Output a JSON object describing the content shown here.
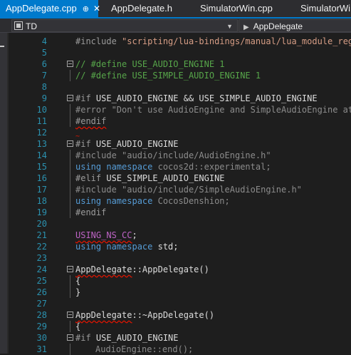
{
  "tabs": [
    {
      "label": "AppDelegate.cpp",
      "active": true,
      "pin": "⊕",
      "close": "✕"
    },
    {
      "label": "AppDelegate.h",
      "active": false
    },
    {
      "label": "SimulatorWin.cpp",
      "active": false
    },
    {
      "label": "SimulatorWin",
      "active": false
    }
  ],
  "nav": {
    "project": "TD",
    "member": "AppDelegate"
  },
  "lines": [
    {
      "num": "4",
      "parts": [
        {
          "t": "#include ",
          "c": "t-pre"
        },
        {
          "t": "\"scripting/lua-bindings/manual/lua_module_regis",
          "c": "t-str"
        }
      ]
    },
    {
      "num": "5",
      "parts": []
    },
    {
      "num": "6",
      "fold": true,
      "parts": [
        {
          "t": "// #define USE_AUDIO_ENGINE 1",
          "c": "t-cmt"
        }
      ]
    },
    {
      "num": "7",
      "guide": true,
      "parts": [
        {
          "t": "// #define USE_SIMPLE_AUDIO_ENGINE 1",
          "c": "t-cmt"
        }
      ]
    },
    {
      "num": "8",
      "parts": []
    },
    {
      "num": "9",
      "fold": true,
      "parts": [
        {
          "t": "#if ",
          "c": "t-pre"
        },
        {
          "t": "USE_AUDIO_ENGINE && USE_SIMPLE_AUDIO_ENGINE",
          "c": "t-plain"
        }
      ]
    },
    {
      "num": "10",
      "guide": true,
      "parts": [
        {
          "t": "#error ",
          "c": "t-gray"
        },
        {
          "t": "\"Don't use AudioEngine and SimpleAudioEngine at t",
          "c": "t-gray"
        }
      ]
    },
    {
      "num": "11",
      "guide": true,
      "parts": [
        {
          "t": "#endif",
          "c": "t-pre",
          "squig": true
        }
      ]
    },
    {
      "num": "12",
      "squigmark": "~",
      "parts": []
    },
    {
      "num": "13",
      "fold": true,
      "parts": [
        {
          "t": "#if ",
          "c": "t-pre"
        },
        {
          "t": "USE_AUDIO_ENGINE",
          "c": "t-plain"
        }
      ]
    },
    {
      "num": "14",
      "guide": true,
      "parts": [
        {
          "t": "#include ",
          "c": "t-gray"
        },
        {
          "t": "\"audio/include/AudioEngine.h\"",
          "c": "t-gray"
        }
      ]
    },
    {
      "num": "15",
      "guide": true,
      "parts": [
        {
          "t": "using ",
          "c": "t-kw"
        },
        {
          "t": "namespace ",
          "c": "t-kw"
        },
        {
          "t": "cocos2d::experimental;",
          "c": "t-gray"
        }
      ]
    },
    {
      "num": "16",
      "guide": true,
      "parts": [
        {
          "t": "#elif ",
          "c": "t-pre"
        },
        {
          "t": "USE_SIMPLE_AUDIO_ENGINE",
          "c": "t-plain"
        }
      ]
    },
    {
      "num": "17",
      "guide": true,
      "parts": [
        {
          "t": "#include ",
          "c": "t-gray"
        },
        {
          "t": "\"audio/include/SimpleAudioEngine.h\"",
          "c": "t-gray"
        }
      ]
    },
    {
      "num": "18",
      "guide": true,
      "parts": [
        {
          "t": "using ",
          "c": "t-kw"
        },
        {
          "t": "namespace ",
          "c": "t-kw"
        },
        {
          "t": "CocosDenshion;",
          "c": "t-gray"
        }
      ]
    },
    {
      "num": "19",
      "guide": true,
      "parts": [
        {
          "t": "#endif",
          "c": "t-pre"
        }
      ]
    },
    {
      "num": "20",
      "parts": []
    },
    {
      "num": "21",
      "parts": [
        {
          "t": "USING_NS_CC",
          "c": "t-macro",
          "squig": true
        },
        {
          "t": ";",
          "c": "t-plain"
        }
      ]
    },
    {
      "num": "22",
      "parts": [
        {
          "t": "using ",
          "c": "t-kw"
        },
        {
          "t": "namespace ",
          "c": "t-kw"
        },
        {
          "t": "std;",
          "c": "t-plain"
        }
      ]
    },
    {
      "num": "23",
      "parts": []
    },
    {
      "num": "24",
      "fold": true,
      "parts": [
        {
          "t": "AppDelegate",
          "c": "t-plain",
          "squig": true
        },
        {
          "t": "::AppDelegate()",
          "c": "t-plain"
        }
      ]
    },
    {
      "num": "25",
      "guide": true,
      "parts": [
        {
          "t": "{",
          "c": "t-plain"
        }
      ]
    },
    {
      "num": "26",
      "guide": true,
      "parts": [
        {
          "t": "}",
          "c": "t-plain"
        }
      ]
    },
    {
      "num": "27",
      "parts": []
    },
    {
      "num": "28",
      "fold": true,
      "parts": [
        {
          "t": "AppDelegate",
          "c": "t-plain",
          "squig": true
        },
        {
          "t": "::~AppDelegate()",
          "c": "t-plain"
        }
      ]
    },
    {
      "num": "29",
      "guide": true,
      "parts": [
        {
          "t": "{",
          "c": "t-plain"
        }
      ]
    },
    {
      "num": "30",
      "fold": true,
      "parts": [
        {
          "t": "#if ",
          "c": "t-pre"
        },
        {
          "t": "USE_AUDIO_ENGINE",
          "c": "t-plain"
        }
      ]
    },
    {
      "num": "31",
      "guide": true,
      "indent": true,
      "parts": [
        {
          "t": "AudioEngine::end();",
          "c": "t-gray"
        }
      ]
    }
  ]
}
